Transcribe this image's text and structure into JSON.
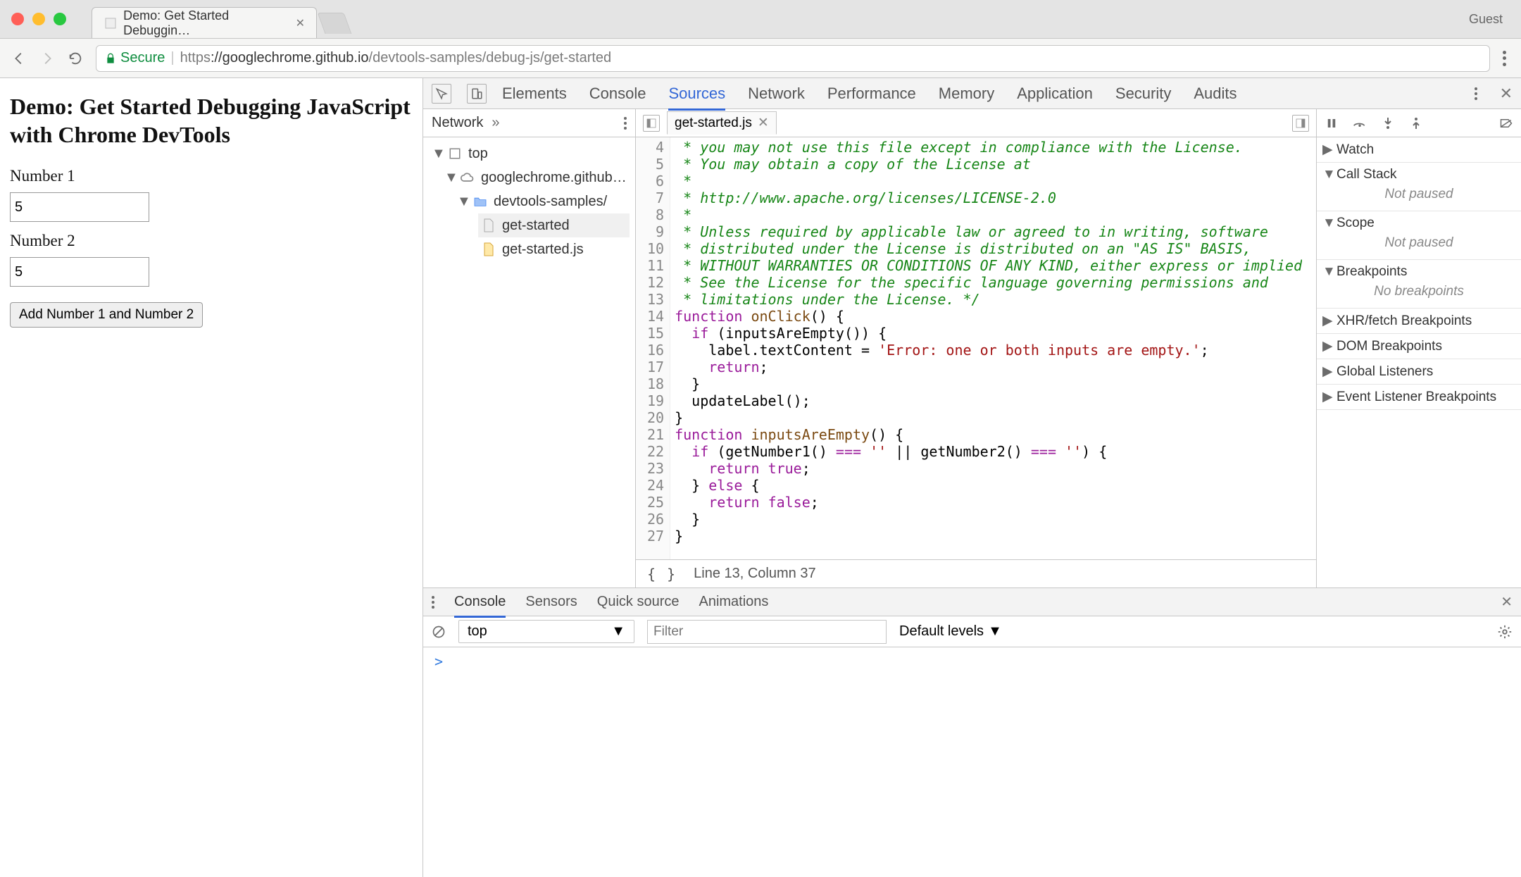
{
  "window": {
    "tab_title": "Demo: Get Started Debuggin…",
    "guest_label": "Guest"
  },
  "address_bar": {
    "secure_label": "Secure",
    "url_scheme": "https",
    "url_host": "://googlechrome.github.io",
    "url_path": "/devtools-samples/debug-js/get-started"
  },
  "page": {
    "heading": "Demo: Get Started Debugging JavaScript with Chrome DevTools",
    "label1": "Number 1",
    "input1_value": "5",
    "label2": "Number 2",
    "input2_value": "5",
    "button_label": "Add Number 1 and Number 2"
  },
  "devtools": {
    "panels": [
      "Elements",
      "Console",
      "Sources",
      "Network",
      "Performance",
      "Memory",
      "Application",
      "Security",
      "Audits"
    ],
    "active_panel": "Sources",
    "navigator": {
      "head_tab": "Network",
      "tree": {
        "root": "top",
        "domain": "googlechrome.github…",
        "folder": "devtools-samples/",
        "files": [
          "get-started",
          "get-started.js"
        ]
      }
    },
    "editor": {
      "open_file": "get-started.js",
      "first_line_no": 4,
      "lines": [
        {
          "n": 4,
          "html": "<span class='c-com'> * you may not use this file except in compliance with the License.</span>"
        },
        {
          "n": 5,
          "html": "<span class='c-com'> * You may obtain a copy of the License at</span>"
        },
        {
          "n": 6,
          "html": "<span class='c-com'> *</span>"
        },
        {
          "n": 7,
          "html": "<span class='c-com'> * http://www.apache.org/licenses/LICENSE-2.0</span>"
        },
        {
          "n": 8,
          "html": "<span class='c-com'> *</span>"
        },
        {
          "n": 9,
          "html": "<span class='c-com'> * Unless required by applicable law or agreed to in writing, software</span>"
        },
        {
          "n": 10,
          "html": "<span class='c-com'> * distributed under the License is distributed on an \"AS IS\" BASIS,</span>"
        },
        {
          "n": 11,
          "html": "<span class='c-com'> * WITHOUT WARRANTIES OR CONDITIONS OF ANY KIND, either express or implied</span>"
        },
        {
          "n": 12,
          "html": "<span class='c-com'> * See the License for the specific language governing permissions and</span>"
        },
        {
          "n": 13,
          "html": "<span class='c-com'> * limitations under the License. */</span>"
        },
        {
          "n": 14,
          "html": "<span class='c-kw'>function</span> <span class='c-fn'>onClick</span>() {"
        },
        {
          "n": 15,
          "html": "  <span class='c-kw'>if</span> (inputsAreEmpty()) {"
        },
        {
          "n": 16,
          "html": "    label.textContent = <span class='c-str'>'Error: one or both inputs are empty.'</span>;"
        },
        {
          "n": 17,
          "html": "    <span class='c-kw'>return</span>;"
        },
        {
          "n": 18,
          "html": "  }"
        },
        {
          "n": 19,
          "html": "  updateLabel();"
        },
        {
          "n": 20,
          "html": "}"
        },
        {
          "n": 21,
          "html": "<span class='c-kw'>function</span> <span class='c-fn'>inputsAreEmpty</span>() {"
        },
        {
          "n": 22,
          "html": "  <span class='c-kw'>if</span> (getNumber1() <span class='c-op'>===</span> <span class='c-str'>''</span> || getNumber2() <span class='c-op'>===</span> <span class='c-str'>''</span>) {"
        },
        {
          "n": 23,
          "html": "    <span class='c-kw'>return</span> <span class='c-kw'>true</span>;"
        },
        {
          "n": 24,
          "html": "  } <span class='c-kw'>else</span> {"
        },
        {
          "n": 25,
          "html": "    <span class='c-kw'>return</span> <span class='c-kw'>false</span>;"
        },
        {
          "n": 26,
          "html": "  }"
        },
        {
          "n": 27,
          "html": "}"
        }
      ],
      "status": "Line 13, Column 37"
    },
    "debugger": {
      "sections": [
        {
          "name": "Watch",
          "open": false
        },
        {
          "name": "Call Stack",
          "open": true,
          "body": "Not paused"
        },
        {
          "name": "Scope",
          "open": true,
          "body": "Not paused"
        },
        {
          "name": "Breakpoints",
          "open": true,
          "body": "No breakpoints"
        },
        {
          "name": "XHR/fetch Breakpoints",
          "open": false
        },
        {
          "name": "DOM Breakpoints",
          "open": false
        },
        {
          "name": "Global Listeners",
          "open": false
        },
        {
          "name": "Event Listener Breakpoints",
          "open": false
        }
      ]
    },
    "drawer": {
      "tabs": [
        "Console",
        "Sensors",
        "Quick source",
        "Animations"
      ],
      "active_tab": "Console",
      "context": "top",
      "filter_placeholder": "Filter",
      "levels_label": "Default levels",
      "prompt": ">"
    }
  }
}
